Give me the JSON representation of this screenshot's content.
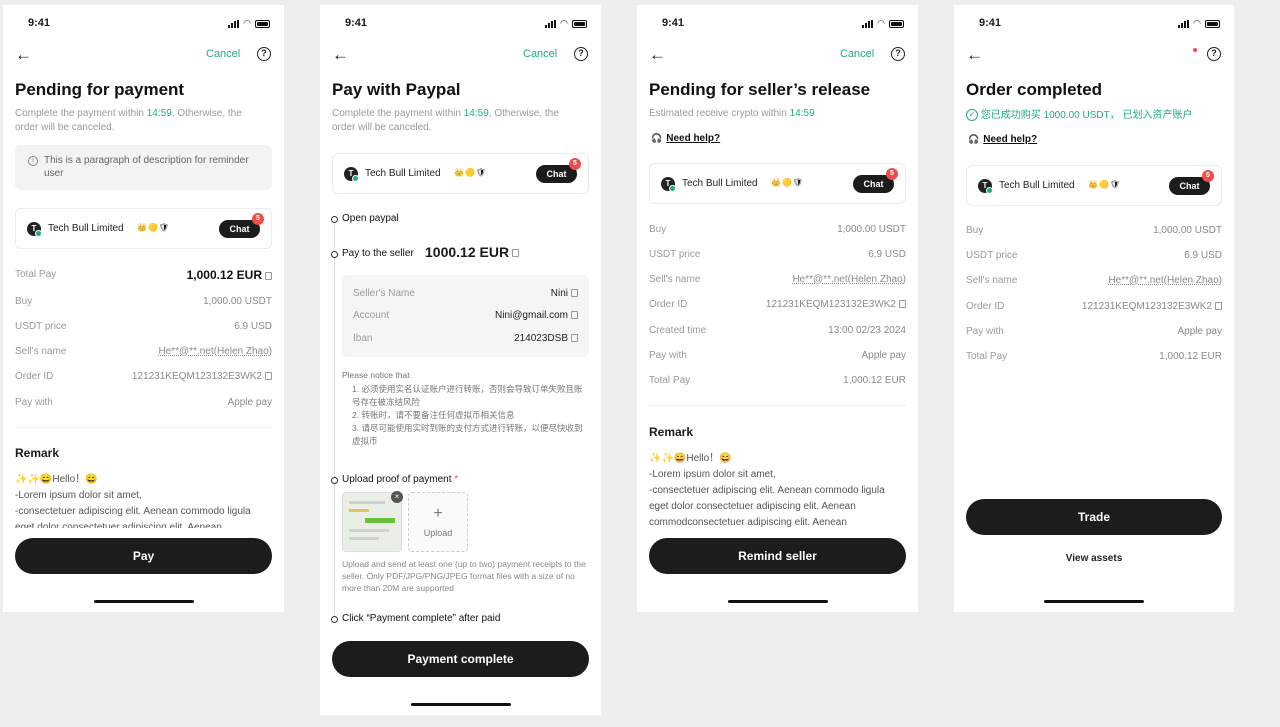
{
  "status": {
    "time": "9:41"
  },
  "cancel": "Cancel",
  "help": "?",
  "back": "←",
  "seller": {
    "initial": "T",
    "name": "Tech Bull Limited",
    "badges": "👑🟡🛡",
    "chat": "Chat",
    "chat_count": "5"
  },
  "screen1": {
    "title": "Pending for payment",
    "sub_pre": "Complete the payment within ",
    "sub_time": "14:59",
    "sub_post": ", Otherwise, the order will be canceled.",
    "tip": "This is a paragraph of description for reminder user",
    "rows": [
      {
        "k": "Total Pay",
        "v": "1,000.12 EUR"
      },
      {
        "k": "Buy",
        "v": "1,000.00 USDT"
      },
      {
        "k": "USDT price",
        "v": "6.9 USD"
      },
      {
        "k": "Sell's name",
        "v": "He**@**.net(Helen Zhao)"
      },
      {
        "k": "Order ID",
        "v": "121231KEQM123132E3WK2"
      },
      {
        "k": "Pay with",
        "v": "Apple pay"
      }
    ],
    "remark_title": "Remark",
    "remark_lines": [
      "✨✨😄Hello！😄",
      "-Lorem ipsum dolor sit amet,",
      "-consectetuer adipiscing elit. Aenean commodo ligula",
      "eget dolor consectetuer adipiscing elit. Aenean"
    ],
    "button": "Pay"
  },
  "screen2": {
    "title": "Pay with Paypal",
    "sub_pre": "Complete the payment within ",
    "sub_time": "14:59",
    "sub_post": ", Otherwise, the order will be canceled.",
    "step1": "Open paypal",
    "step2": "Pay to the seller",
    "amount": "1000.12 EUR",
    "seller_rows": [
      {
        "k": "Seller's Name",
        "v": "Nini"
      },
      {
        "k": "Account",
        "v": "Nini@gmail.com"
      },
      {
        "k": "Iban",
        "v": "214023DSB"
      }
    ],
    "notice_title": "Please notice that",
    "notice_items": [
      "1. 必须使用实名认证账户进行转账，否则会导致订单失败且账号存在被冻结风险",
      "2. 转账时，请不要备注任何虚拟币相关信息",
      "3. 请尽可能使用实时到账的支付方式进行转账，以便尽快收到虚拟币"
    ],
    "step3": "Upload proof of payment",
    "required": "*",
    "upload_label": "Upload",
    "upload_note": "Upload and send at least one (up to two) payment receipts to the seller. Only PDF/JPG/PNG/JPEG format files with a size of no more than 20M are supported",
    "step4": "Click “Payment complete” after paid",
    "button": "Payment complete"
  },
  "screen3": {
    "title": "Pending for seller’s release",
    "sub_pre": "Estimated receive crypto within ",
    "sub_time": "14:59",
    "need_help": "Need help?",
    "rows": [
      {
        "k": "Buy",
        "v": "1,000.00 USDT"
      },
      {
        "k": "USDT price",
        "v": "6.9 USD"
      },
      {
        "k": "Sell's name",
        "v": "He**@**.net(Helen Zhao)"
      },
      {
        "k": "Order ID",
        "v": "121231KEQM123132E3WK2"
      },
      {
        "k": "Created time",
        "v": "13:00 02/23 2024"
      },
      {
        "k": "Pay with",
        "v": "Apple pay"
      },
      {
        "k": "Total Pay",
        "v": "1,000.12 EUR"
      }
    ],
    "remark_title": "Remark",
    "remark_lines": [
      "✨✨😄Hello！😄",
      "-Lorem ipsum dolor sit amet,",
      "-consectetuer adipiscing elit. Aenean commodo ligula",
      "eget dolor consectetuer adipiscing elit. Aenean",
      "commodconsectetuer adipiscing elit. Aenean"
    ],
    "button": "Remind seller"
  },
  "screen4": {
    "title": "Order completed",
    "success": "您已成功购买 1000.00 USDT， 已划入资产账户",
    "need_help": "Need help?",
    "rows": [
      {
        "k": "Buy",
        "v": "1,000.00 USDT"
      },
      {
        "k": "USDT price",
        "v": "6.9 USD"
      },
      {
        "k": "Sell's name",
        "v": "He**@**.net(Helen Zhao)"
      },
      {
        "k": "Order ID",
        "v": "121231KEQM123132E3WK2"
      },
      {
        "k": "Pay with",
        "v": "Apple pay"
      },
      {
        "k": "Total Pay",
        "v": "1,000.12 EUR"
      }
    ],
    "button": "Trade",
    "view_assets": "View assets"
  }
}
